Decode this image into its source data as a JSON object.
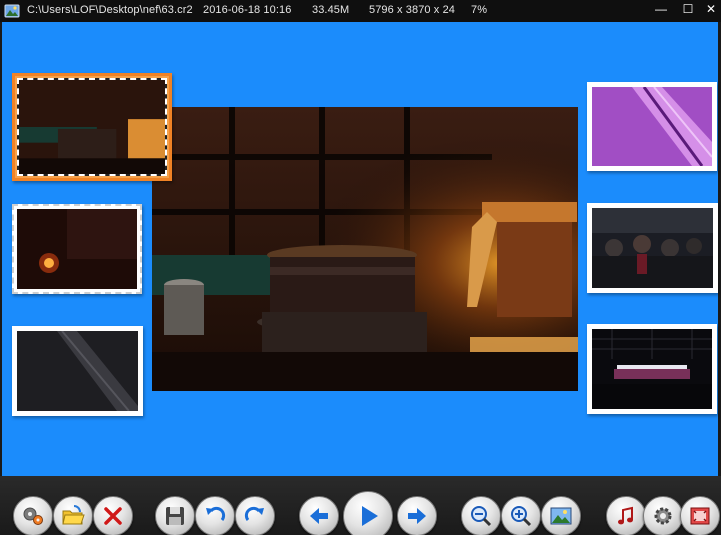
{
  "titlebar": {
    "path": "C:\\Users\\LOF\\Desktop\\nef\\63.cr2",
    "date": "2016-06-18 10:16",
    "size": "33.45M",
    "dimensions": "5796 x 3870 x 24",
    "zoom": "7%",
    "minimize": "—",
    "maximize": "☐",
    "close": "✕"
  },
  "colors": {
    "viewer_background": "#1b8cfc",
    "selected_border": "#f08225"
  },
  "thumbnails": [
    {
      "name": "restaurant-buffet",
      "selected": true,
      "side": "left"
    },
    {
      "name": "dark-room-lamp",
      "selected": false,
      "side": "left"
    },
    {
      "name": "dark-diagonal-detail",
      "selected": false,
      "side": "left"
    },
    {
      "name": "purple-glass-detail",
      "selected": false,
      "side": "right"
    },
    {
      "name": "crowd-exhibition",
      "selected": false,
      "side": "right"
    },
    {
      "name": "exhibition-hall",
      "selected": false,
      "side": "right"
    }
  ],
  "toolbar": {
    "buttons": [
      "settings-gears-icon",
      "open-folder-icon",
      "delete-icon",
      "save-icon",
      "rotate-left-icon",
      "rotate-right-icon",
      "previous-icon",
      "play-icon",
      "next-icon",
      "zoom-out-icon",
      "zoom-in-icon",
      "fit-image-icon",
      "music-icon",
      "options-gear-icon",
      "fullscreen-icon"
    ]
  }
}
